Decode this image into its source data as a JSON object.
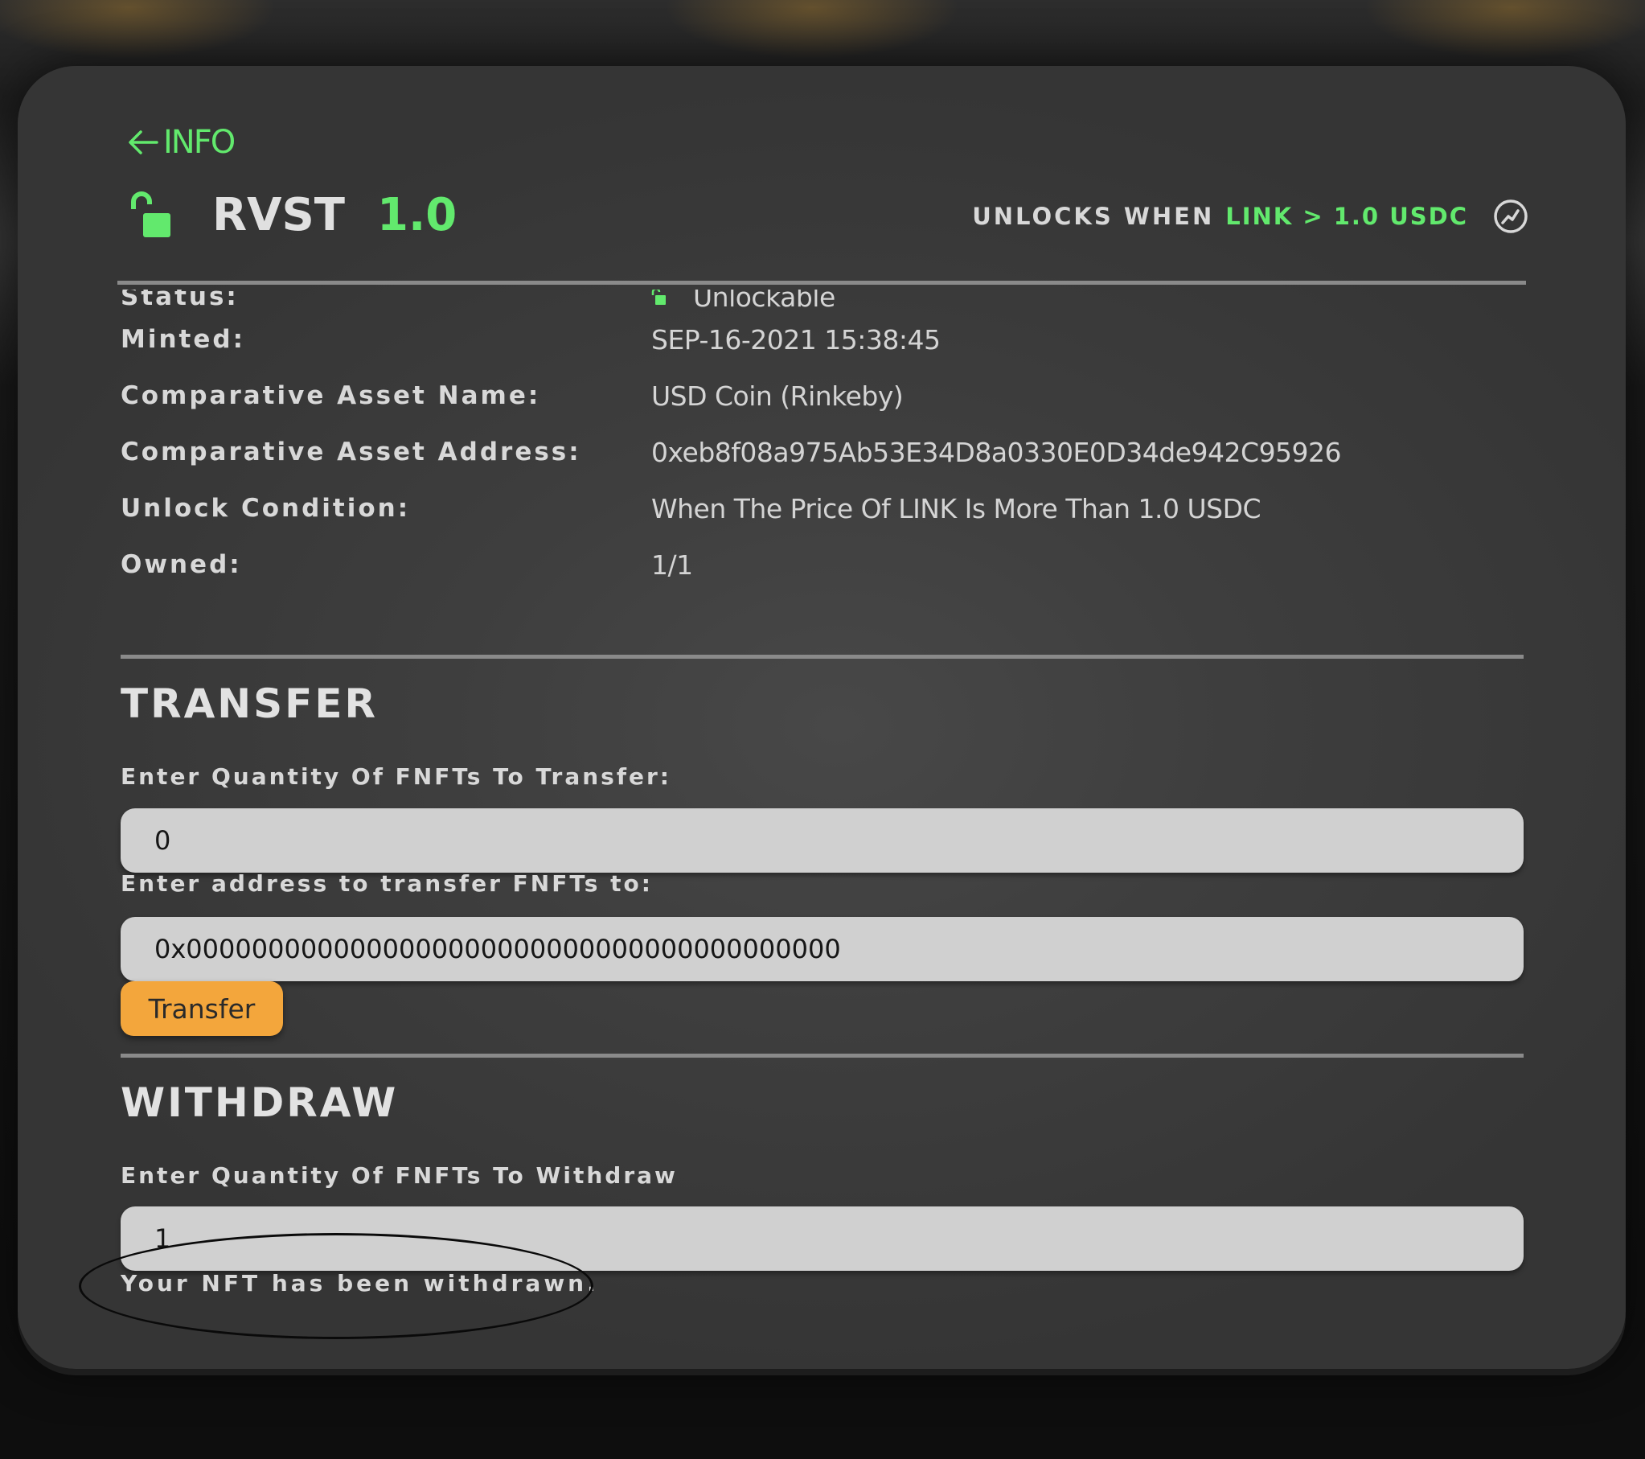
{
  "header": {
    "back_label": "INFO",
    "token_name": "RVST",
    "token_version": "1.0",
    "unlock_prefix": "UNLOCKS WHEN",
    "unlock_condition": "LINK > 1.0 USDC",
    "chart_icon": "chart-trend-icon",
    "lock_icon": "unlocked-padlock-icon"
  },
  "info": {
    "rows": [
      {
        "label": "Status:",
        "value": "Unlockable"
      },
      {
        "label": "Minted:",
        "value": "SEP-16-2021 15:38:45"
      },
      {
        "label": "Comparative Asset Name:",
        "value": "USD Coin (Rinkeby)"
      },
      {
        "label": "Comparative Asset Address:",
        "value": "0xeb8f08a975Ab53E34D8a0330E0D34de942C95926"
      },
      {
        "label": "Unlock Condition:",
        "value": "When The Price Of LINK Is More Than 1.0 USDC"
      },
      {
        "label": "Owned:",
        "value": "1/1"
      }
    ]
  },
  "transfer": {
    "title": "TRANSFER",
    "quantity_label": "Enter Quantity Of FNFTs To Transfer:",
    "quantity_value": "0",
    "address_label": "Enter address to transfer FNFTs to:",
    "address_value": "0x0000000000000000000000000000000000000000",
    "button_label": "Transfer"
  },
  "withdraw": {
    "title": "WITHDRAW",
    "quantity_label": "Enter Quantity Of FNFTs To Withdraw",
    "quantity_value": "1",
    "message": "Your NFT has been withdrawn."
  },
  "colors": {
    "accent_green": "#62e96d",
    "button_orange": "#f3a63c",
    "card_bg": "#3e3e3e"
  }
}
